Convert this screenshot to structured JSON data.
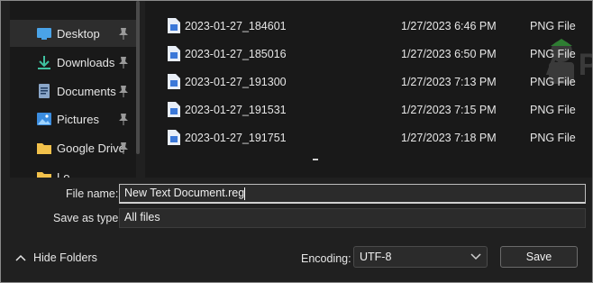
{
  "sidebar": {
    "items": [
      {
        "label": "Desktop",
        "icon": "desktop-icon",
        "pinned": true,
        "selected": true
      },
      {
        "label": "Downloads",
        "icon": "download-icon",
        "pinned": true
      },
      {
        "label": "Documents",
        "icon": "documents-icon",
        "pinned": true
      },
      {
        "label": "Pictures",
        "icon": "pictures-icon",
        "pinned": true
      },
      {
        "label": "Google Drive",
        "icon": "folder-icon",
        "pinned": true
      },
      {
        "label": "Lo",
        "icon": "folder-icon",
        "pinned": false
      }
    ]
  },
  "files": [
    {
      "name": "2023-01-27_184601",
      "date": "1/27/2023 6:46 PM",
      "type": "PNG File"
    },
    {
      "name": "2023-01-27_185016",
      "date": "1/27/2023 6:50 PM",
      "type": "PNG File"
    },
    {
      "name": "2023-01-27_191300",
      "date": "1/27/2023 7:13 PM",
      "type": "PNG File"
    },
    {
      "name": "2023-01-27_191531",
      "date": "1/27/2023 7:15 PM",
      "type": "PNG File"
    },
    {
      "name": "2023-01-27_191751",
      "date": "1/27/2023 7:18 PM",
      "type": "PNG File"
    }
  ],
  "watermark": "A  PUALS",
  "form": {
    "filename_label": "File name:",
    "filename_value": "New Text Document.reg",
    "savetype_label": "Save as type:",
    "savetype_value": "All files",
    "hide_folders": "Hide Folders",
    "encoding_label": "Encoding:",
    "encoding_value": "UTF-8",
    "save_label": "Save"
  },
  "colors": {
    "background": "#202020",
    "pane": "#191919",
    "file_icon": "#3b78d8",
    "accent_blue": "#4aa3e8"
  }
}
